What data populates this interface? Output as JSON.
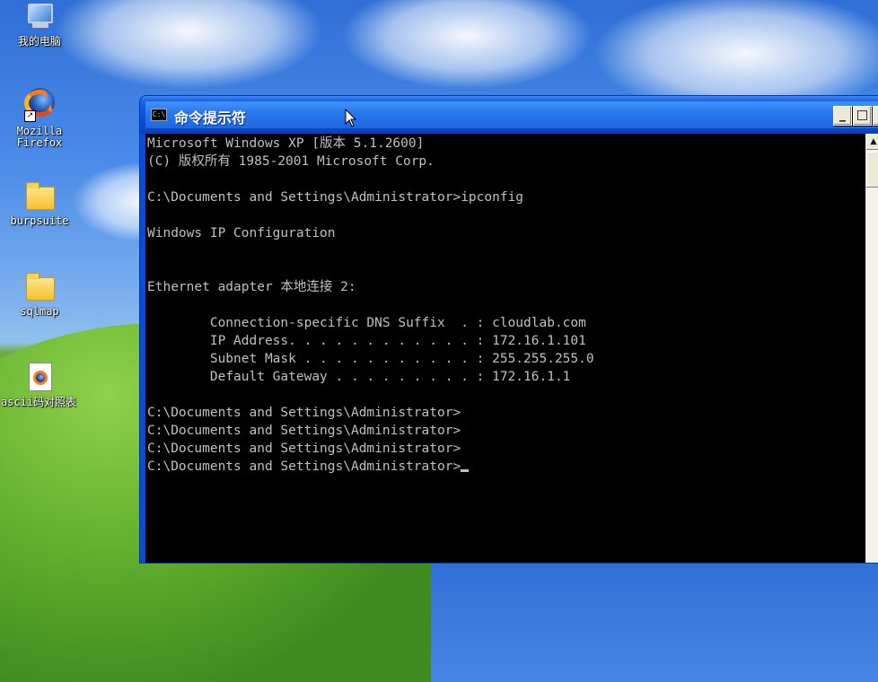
{
  "desktop": {
    "icons": [
      {
        "label": "我的电脑",
        "icon": "computer-icon"
      },
      {
        "label": "Mozilla Firefox",
        "icon": "firefox-icon"
      },
      {
        "label": "burpsuite",
        "icon": "folder-icon"
      },
      {
        "label": "sqlmap",
        "icon": "folder-icon"
      },
      {
        "label": "ascii码对照表",
        "icon": "firefox-document-icon"
      }
    ]
  },
  "window": {
    "title": "命令提示符",
    "icon_text": "C:\\",
    "buttons": {
      "minimize": "_",
      "maximize": "□",
      "close": "×"
    }
  },
  "console": {
    "lines": [
      "Microsoft Windows XP [版本 5.1.2600]",
      "(C) 版权所有 1985-2001 Microsoft Corp.",
      "",
      "C:\\Documents and Settings\\Administrator>ipconfig",
      "",
      "Windows IP Configuration",
      "",
      "",
      "Ethernet adapter 本地连接 2:",
      "",
      "        Connection-specific DNS Suffix  . : cloudlab.com",
      "        IP Address. . . . . . . . . . . . : 172.16.1.101",
      "        Subnet Mask . . . . . . . . . . . : 255.255.255.0",
      "        Default Gateway . . . . . . . . . : 172.16.1.1",
      "",
      "C:\\Documents and Settings\\Administrator>",
      "C:\\Documents and Settings\\Administrator>",
      "C:\\Documents and Settings\\Administrator>",
      "C:\\Documents and Settings\\Administrator>"
    ]
  },
  "colors": {
    "console_bg": "#000000",
    "console_fg": "#c0c0c0",
    "titlebar": "#0a4fdf"
  }
}
